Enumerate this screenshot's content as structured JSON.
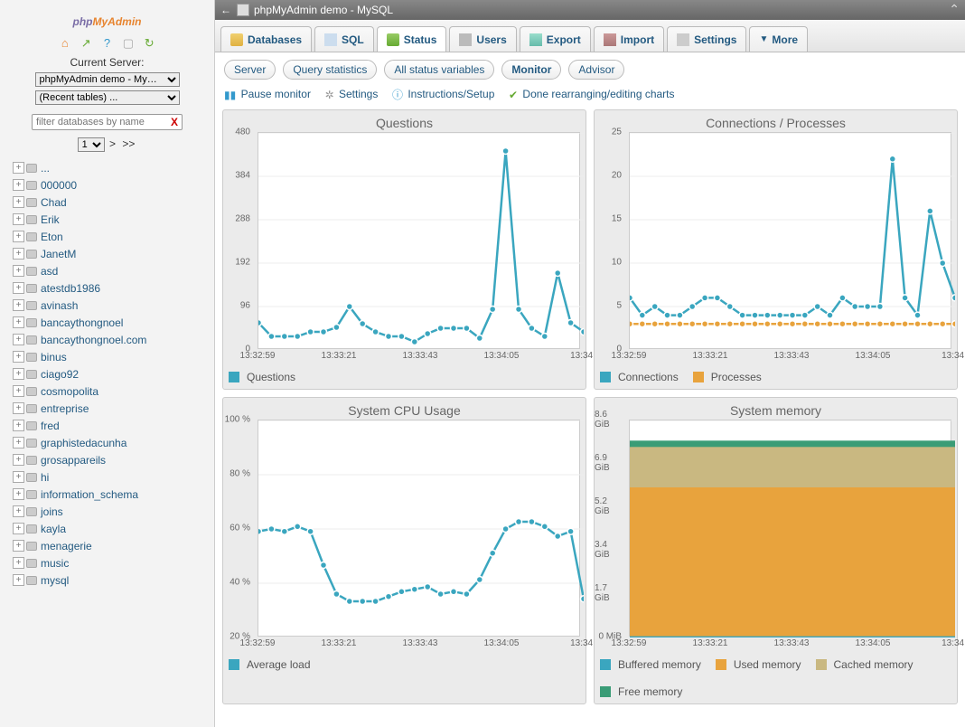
{
  "logo": {
    "a": "php",
    "b": "My",
    "c": "Admin"
  },
  "current_server_label": "Current Server:",
  "server_select": "phpMyAdmin demo - My…",
  "recent_select": "(Recent tables) ...",
  "filter_placeholder": "filter databases by name",
  "pager": {
    "value": "1",
    "next": ">",
    "last": ">>"
  },
  "databases": [
    "...",
    "000000",
    "Chad",
    "Erik",
    "Eton",
    "JanetM",
    "asd",
    "atestdb1986",
    "avinash",
    "bancaythongnoel",
    "bancaythongnoel.com",
    "binus",
    "ciago92",
    "cosmopolita",
    "entreprise",
    "fred",
    "graphistedacunha",
    "grosappareils",
    "hi",
    "information_schema",
    "joins",
    "kayla",
    "menagerie",
    "music",
    "mysql"
  ],
  "titlebar": {
    "text": "phpMyAdmin demo - MySQL"
  },
  "tabs": [
    {
      "label": "Databases",
      "icon": "db"
    },
    {
      "label": "SQL",
      "icon": "sql"
    },
    {
      "label": "Status",
      "icon": "status",
      "active": true
    },
    {
      "label": "Users",
      "icon": "users"
    },
    {
      "label": "Export",
      "icon": "export"
    },
    {
      "label": "Import",
      "icon": "import"
    },
    {
      "label": "Settings",
      "icon": "settings"
    },
    {
      "label": "More",
      "icon": "more",
      "dropdown": true
    }
  ],
  "subtabs": [
    "Server",
    "Query statistics",
    "All status variables",
    "Monitor",
    "Advisor"
  ],
  "subtab_active": "Monitor",
  "toolbar": {
    "pause": "Pause monitor",
    "settings": "Settings",
    "instructions": "Instructions/Setup",
    "done": "Done rearranging/editing charts"
  },
  "x_ticks": [
    "13:32:59",
    "13:33:21",
    "13:33:43",
    "13:34:05",
    "13:34:"
  ],
  "colors": {
    "teal": "#3aa6bf",
    "orange": "#e8a33d",
    "tan": "#c9b881",
    "green": "#3a9c76"
  },
  "chart_data": [
    {
      "type": "line",
      "title": "Questions",
      "y_ticks": [
        0,
        96,
        192,
        288,
        384,
        480
      ],
      "series": [
        {
          "name": "Questions",
          "color": "teal",
          "values": [
            60,
            30,
            30,
            30,
            40,
            40,
            50,
            96,
            58,
            40,
            30,
            30,
            18,
            36,
            48,
            48,
            48,
            26,
            90,
            440,
            90,
            48,
            30,
            170,
            60,
            40
          ]
        }
      ],
      "legend": [
        "Questions"
      ]
    },
    {
      "type": "line",
      "title": "Connections / Processes",
      "y_ticks": [
        0,
        5,
        10,
        15,
        20,
        25
      ],
      "series": [
        {
          "name": "Connections",
          "color": "teal",
          "values": [
            6,
            4,
            5,
            4,
            4,
            5,
            6,
            6,
            5,
            4,
            4,
            4,
            4,
            4,
            4,
            5,
            4,
            6,
            5,
            5,
            5,
            22,
            6,
            4,
            16,
            10,
            6
          ]
        },
        {
          "name": "Processes",
          "color": "orange",
          "values": [
            3,
            3,
            3,
            3,
            3,
            3,
            3,
            3,
            3,
            3,
            3,
            3,
            3,
            3,
            3,
            3,
            3,
            3,
            3,
            3,
            3,
            3,
            3,
            3,
            3,
            3,
            3
          ]
        }
      ],
      "legend": [
        "Connections",
        "Processes"
      ]
    },
    {
      "type": "line",
      "title": "System CPU Usage",
      "y_ticks": [
        "20 %",
        "40 %",
        "60 %",
        "80 %",
        "100 %"
      ],
      "y_range": [
        10,
        100
      ],
      "series": [
        {
          "name": "Average load",
          "color": "teal",
          "values": [
            54,
            55,
            54,
            56,
            54,
            40,
            28,
            25,
            25,
            25,
            27,
            29,
            30,
            31,
            28,
            29,
            28,
            34,
            45,
            55,
            58,
            58,
            56,
            52,
            54,
            26
          ]
        }
      ],
      "legend": [
        "Average load"
      ]
    },
    {
      "type": "area",
      "title": "System memory",
      "y_ticks": [
        "0 MiB",
        "1.7 GiB",
        "3.4 GiB",
        "5.2 GiB",
        "6.9 GiB",
        "8.6 GiB"
      ],
      "y_max": 8.6,
      "stack": [
        {
          "name": "Buffered memory",
          "color": "teal",
          "value": 0.05
        },
        {
          "name": "Used memory",
          "color": "orange",
          "value": 5.9
        },
        {
          "name": "Cached memory",
          "color": "tan",
          "value": 1.6
        },
        {
          "name": "Free memory",
          "color": "green",
          "value": 0.25
        }
      ],
      "legend": [
        "Buffered memory",
        "Used memory",
        "Cached memory",
        "Free memory"
      ]
    }
  ]
}
